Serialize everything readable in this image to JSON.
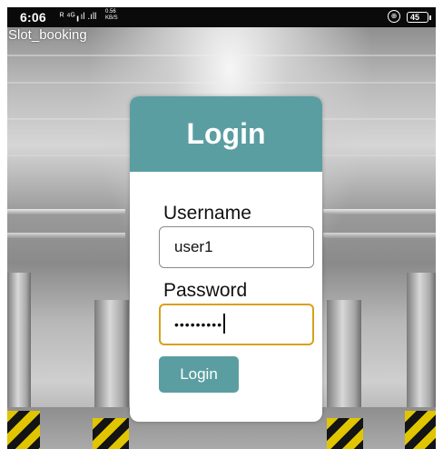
{
  "status_bar": {
    "time": "6:06",
    "signal_text": "ᴿ ⁴ᴳ╻ıl .ıll",
    "net_speed": "0.56",
    "net_unit": "KB/S",
    "vpn_glyph": "⊕",
    "battery": "45"
  },
  "app": {
    "title": "Slot_booking"
  },
  "login": {
    "heading": "Login",
    "username_label": "Username",
    "username_value": "user1",
    "password_label": "Password",
    "password_value": "•••••••••",
    "submit_label": "Login"
  },
  "colors": {
    "accent": "#5b9ea1",
    "focus_border": "#d7a11a",
    "hazard_yellow": "#e0c500"
  }
}
